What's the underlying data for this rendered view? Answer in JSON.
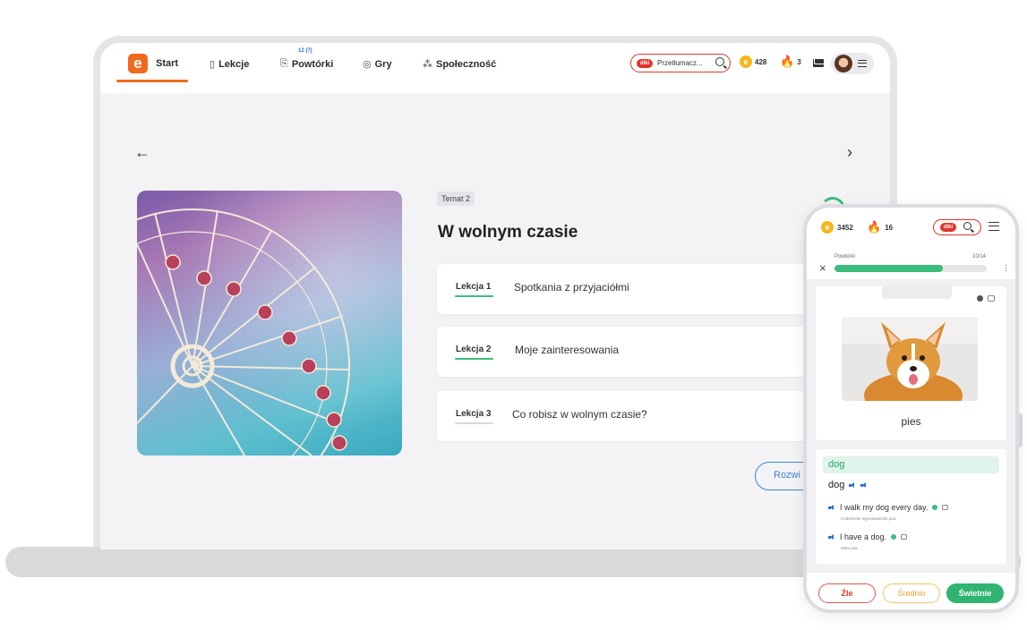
{
  "colors": {
    "accent": "#f06a1d",
    "green": "#3dbd7d",
    "blue": "#3b82d8",
    "red": "#e1342b"
  },
  "nav": {
    "logo": "e",
    "items": [
      {
        "label": "Start",
        "icon": "home-logo-icon"
      },
      {
        "label": "Lekcje",
        "icon": "book-icon"
      },
      {
        "label": "Powtórki",
        "icon": "repeat-cards-icon",
        "badge": "12 (7)"
      },
      {
        "label": "Gry",
        "icon": "gamepad-icon"
      },
      {
        "label": "Społeczność",
        "icon": "community-icon"
      }
    ],
    "translator_placeholder": "Przetłumacz...",
    "diki_logo": "diki",
    "coins": "428",
    "streak": "3"
  },
  "main": {
    "topic_badge": "Temat 2",
    "topic_title": "W wolnym czasie",
    "lessons": [
      {
        "number": "Lekcja 1",
        "title": "Spotkania z przyjaciółmi",
        "completed": true
      },
      {
        "number": "Lekcja 2",
        "title": "Moje zainteresowania",
        "completed": true
      },
      {
        "number": "Lekcja 3",
        "title": "Co robisz w wolnym czasie?",
        "completed": false
      }
    ],
    "expand_label": "Rozwi"
  },
  "phone": {
    "coins": "3452",
    "streak": "16",
    "progress_label": "Powtórki",
    "progress_count": "10/14",
    "progress_fraction": 0.714,
    "word": "pies",
    "answer": "dog",
    "headword": "dog",
    "examples": [
      {
        "sentence": "I walk my dog every day.",
        "translation": "Codziennie wyprowadzam psa."
      },
      {
        "sentence": "I have a dog.",
        "translation": "Mam psa."
      }
    ],
    "buttons": {
      "bad": "Źle",
      "mid": "Średnio",
      "good": "Świetnie"
    }
  }
}
